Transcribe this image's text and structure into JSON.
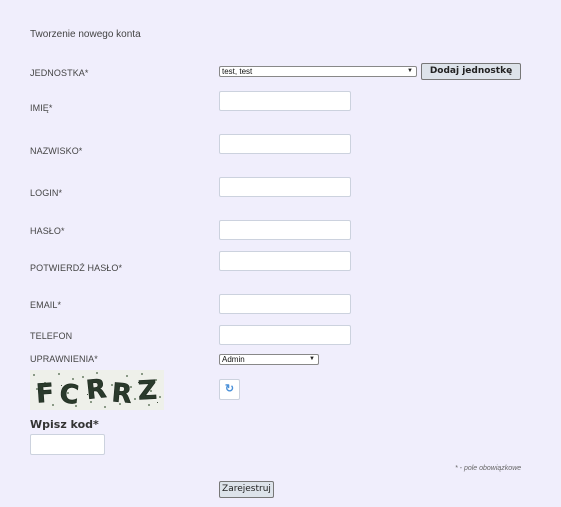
{
  "form": {
    "title": "Tworzenie nowego konta",
    "unit_label": "JEDNOSTKA*",
    "unit_value": "test, test",
    "add_unit_label": "Dodaj jednostkę",
    "first_name_label": "IMIĘ*",
    "last_name_label": "NAZWISKO*",
    "login_label": "LOGIN*",
    "password_label": "HASŁO*",
    "confirm_password_label": "POTWIERDŹ HASŁO*",
    "email_label": "EMAIL*",
    "phone_label": "TELEFON",
    "permissions_label": "UPRAWNIENIA*",
    "permissions_value": "Admin",
    "captcha_text": "FCRRZ",
    "enter_code_label": "Wpisz kod*",
    "required_note": "* - pole obowiązkowe",
    "submit_label": "Zarejestruj"
  },
  "icons": {
    "dropdown": "chevron-down-icon",
    "refresh": "refresh-icon"
  }
}
